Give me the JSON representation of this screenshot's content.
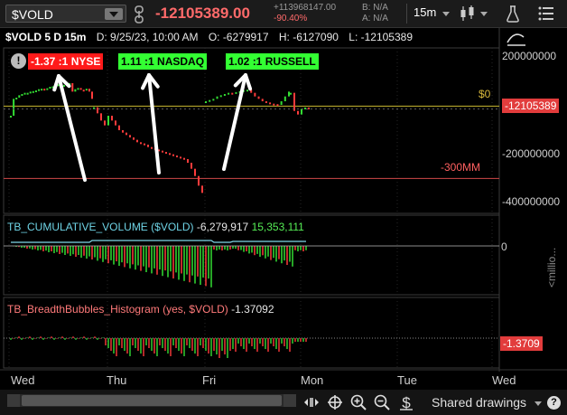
{
  "toolbar": {
    "symbol": "$VOLD",
    "price": "-12105389.00",
    "change_abs": "+113968147.00",
    "change_pct": "-90.40%",
    "bid": "B: N/A",
    "ask": "A: N/A",
    "timeframe": "15m"
  },
  "header": {
    "symbol_period": "$VOLD 5 D 15m",
    "date": "D: 9/25/23, 10:00 AM",
    "open": "O: -6279917",
    "high": "H: -6127090",
    "low": "L: -12105389"
  },
  "breadth_tags": {
    "nyse": "-1.37 :1 NYSE",
    "nasdaq": "1.11 :1 NASDAQ",
    "russell": "1.02 :1 RUSSELL"
  },
  "price_axis": {
    "ticks": [
      "200000000",
      "0",
      "-200000000",
      "-400000000"
    ],
    "last_price_tag": "-12105389",
    "zero_line_label": "$0",
    "minus300_label": "-300MM"
  },
  "cumulative_panel": {
    "name": "TB_CUMULATIVE_VOLUME ($VOLD)",
    "value1": "-6,279,917",
    "value2": "15,353,111",
    "axis_zero": "0",
    "axis_unit": "<millio..."
  },
  "bubbles_panel": {
    "name": "TB_BreadthBubbles_Histogram (yes, $VOLD)",
    "value": "-1.37092",
    "axis_tag": "-1.3709"
  },
  "time_axis": {
    "days": [
      "Wed",
      "Thu",
      "Fri",
      "Mon",
      "Tue",
      "Wed"
    ]
  },
  "bottom_bar": {
    "shared_drawings": "Shared drawings"
  },
  "colors": {
    "up": "#33dd33",
    "down": "#ff3b3b",
    "accent_price": "#ff6a6a",
    "zero_line": "#c8b830",
    "minus300_line": "#d04848",
    "cumulative_line": "#7fd8ea"
  }
}
